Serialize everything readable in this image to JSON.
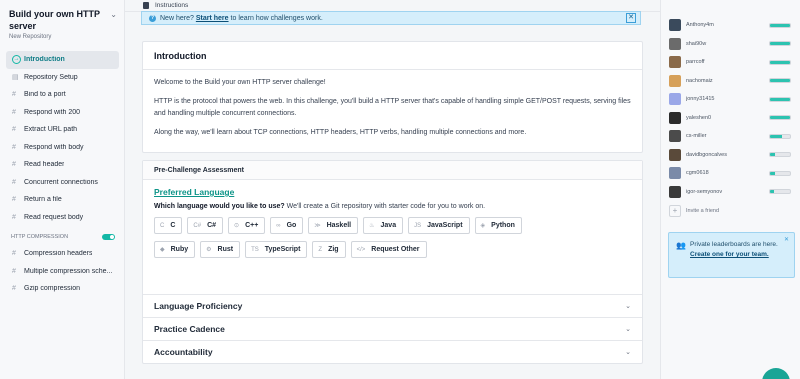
{
  "sidebar": {
    "title": "Build your own HTTP server",
    "subtitle": "New Repository",
    "items": [
      {
        "label": "Introduction",
        "icon": "play-circle-icon",
        "active": true
      },
      {
        "label": "Repository Setup",
        "icon": "document-icon"
      },
      {
        "label": "Bind to a port",
        "icon": "hash-icon"
      },
      {
        "label": "Respond with 200",
        "icon": "hash-icon"
      },
      {
        "label": "Extract URL path",
        "icon": "hash-icon"
      },
      {
        "label": "Respond with body",
        "icon": "hash-icon"
      },
      {
        "label": "Read header",
        "icon": "hash-icon"
      },
      {
        "label": "Concurrent connections",
        "icon": "hash-icon"
      },
      {
        "label": "Return a file",
        "icon": "hash-icon"
      },
      {
        "label": "Read request body",
        "icon": "hash-icon"
      }
    ],
    "extension_title": "HTTP COMPRESSION",
    "extension_items": [
      {
        "label": "Compression headers"
      },
      {
        "label": "Multiple compression sche..."
      },
      {
        "label": "Gzip compression"
      }
    ]
  },
  "tabs": {
    "instructions": "Instructions"
  },
  "banner": {
    "pre": "New here?",
    "link": "Start here",
    "post": "to learn how challenges work."
  },
  "intro": {
    "title": "Introduction",
    "p1": "Welcome to the Build your own HTTP server challenge!",
    "p2": "HTTP is the protocol that powers the web. In this challenge, you'll build a HTTP server that's capable of handling simple GET/POST requests, serving files and handling multiple concurrent connections.",
    "p3": "Along the way, we'll learn about TCP connections, HTTP headers, HTTP verbs, handling multiple connections and more."
  },
  "assessment": {
    "title": "Pre-Challenge Assessment",
    "pref_title": "Preferred Language",
    "question": "Which language would you like to use?",
    "question_rest": "We'll create a Git repository with starter code for you to work on.",
    "languages": [
      {
        "label": "C",
        "icon": "C"
      },
      {
        "label": "C#",
        "icon": "C#"
      },
      {
        "label": "C++",
        "icon": "⊙"
      },
      {
        "label": "Go",
        "icon": "∞"
      },
      {
        "label": "Haskell",
        "icon": "≫"
      },
      {
        "label": "Java",
        "icon": "♨"
      },
      {
        "label": "JavaScript",
        "icon": "JS"
      },
      {
        "label": "Python",
        "icon": "◈"
      },
      {
        "label": "Ruby",
        "icon": "◆"
      },
      {
        "label": "Rust",
        "icon": "⚙"
      },
      {
        "label": "TypeScript",
        "icon": "TS"
      },
      {
        "label": "Zig",
        "icon": "Z"
      },
      {
        "label": "Request Other",
        "icon": "</>"
      }
    ],
    "sections": [
      "Language Proficiency",
      "Practice Cadence",
      "Accountability"
    ]
  },
  "leaderboard": {
    "users": [
      {
        "name": "Anthony4m",
        "progress": 1.0,
        "color": "#3a4a5c"
      },
      {
        "name": "shai90w",
        "progress": 1.0,
        "color": "#6b6b6b"
      },
      {
        "name": "parrcoff",
        "progress": 1.0,
        "color": "#8a6a4a"
      },
      {
        "name": "nachomaiz",
        "progress": 1.0,
        "color": "#d6a05a"
      },
      {
        "name": "jonny31415",
        "progress": 1.0,
        "color": "#9aa7e8"
      },
      {
        "name": "yaleshen0",
        "progress": 1.0,
        "color": "#2b2b2b"
      },
      {
        "name": "cs-miller",
        "progress": 0.6,
        "color": "#4b4b4b"
      },
      {
        "name": "davidbgoncalves",
        "progress": 0.25,
        "color": "#5a4a3a"
      },
      {
        "name": "cgm0618",
        "progress": 0.25,
        "color": "#7a8aa8"
      },
      {
        "name": "igor-semyonov",
        "progress": 0.2,
        "color": "#3a3a3a"
      }
    ],
    "invite": "Invite a friend"
  },
  "private_lb": {
    "text": "Private leaderboards are here.",
    "link": "Create one for your team."
  }
}
